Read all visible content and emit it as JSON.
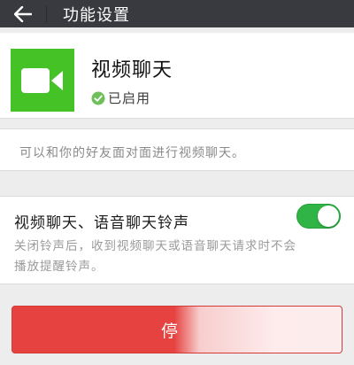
{
  "header": {
    "title": "功能设置",
    "back_icon": "arrow-left-icon"
  },
  "feature": {
    "icon": "video-camera-icon",
    "icon_bg": "#44c226",
    "name": "视频聊天",
    "status_icon": "check-circle-icon",
    "status": "已启用"
  },
  "description": "可以和你的好友面对面进行视频聊天。",
  "ringtone": {
    "title": "视频聊天、语音聊天铃声",
    "description": "关闭铃声后，收到视频聊天或语音聊天请求时不会播放提醒铃声。",
    "enabled": true,
    "toggle_color": "#2fb445"
  },
  "stop_button": {
    "label": "停",
    "color": "#e64340"
  }
}
